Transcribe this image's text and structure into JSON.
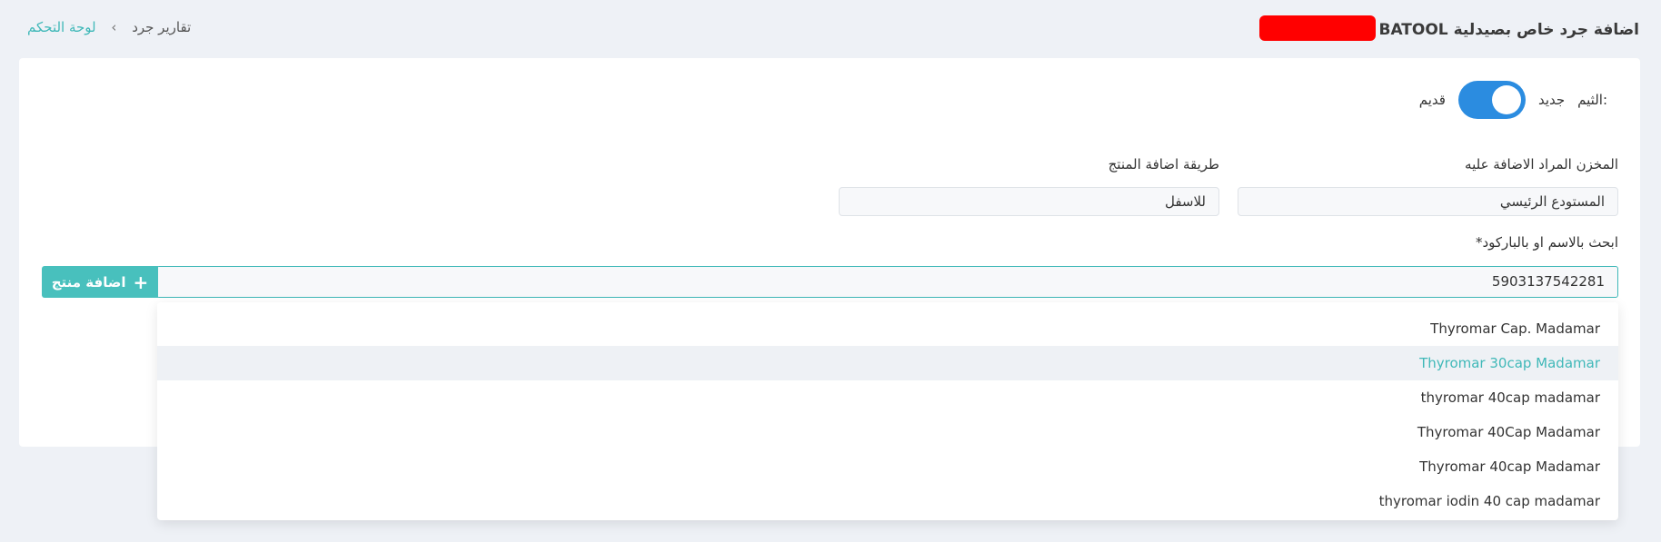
{
  "header": {
    "title_arabic": "اضافة جرد خاص بصيدلية",
    "title_pharmacy": "BATOOL",
    "breadcrumb": {
      "home": "لوحة التحكم",
      "separator": "›",
      "current": "تقارير جرد"
    }
  },
  "form": {
    "theme": {
      "label": "الثيم:",
      "new_label": "جديد",
      "old_label": "قديم",
      "enabled": true
    },
    "warehouse": {
      "label": "المخزن المراد الاضافة عليه",
      "value": "المستودع الرئيسي"
    },
    "add_method": {
      "label": "طريقة اضافة المنتج",
      "value": "للاسفل"
    },
    "search": {
      "label": "ابحث بالاسم او بالباركود*",
      "value": "5903137542281"
    },
    "add_button_label": "اضافة منتج"
  },
  "dropdown": {
    "items": [
      "Thyromar Cap. Madamar",
      "Thyromar 30cap Madamar",
      "thyromar 40cap madamar",
      "Thyromar 40Cap Madamar",
      "Thyromar 40cap Madamar",
      "thyromar iodin 40 cap madamar"
    ],
    "highlighted_index": 1
  },
  "colors": {
    "accent": "#3fb8b8",
    "toggle_on": "#2b8ce0",
    "redaction": "#ff0000"
  }
}
